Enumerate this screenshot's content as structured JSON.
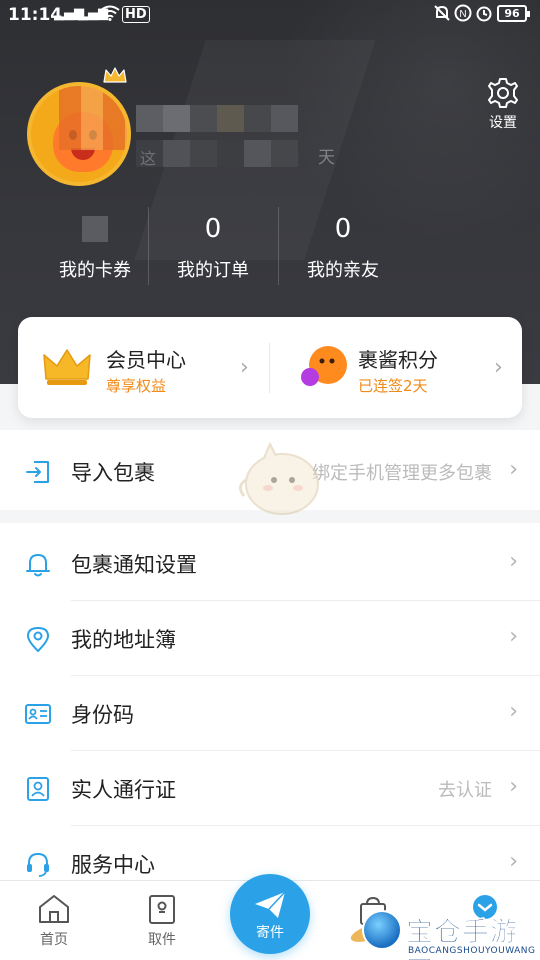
{
  "status_bar": {
    "time": "11:14",
    "signal_1": "▂▄▆ ",
    "signal_2": "▂▄▆",
    "hd": "HD",
    "battery": "96"
  },
  "header": {
    "settings_label": "设置",
    "name_prefix": "这",
    "name_suffix": "天",
    "stats": [
      {
        "label": "我的卡券"
      },
      {
        "value": "0",
        "label": "我的订单"
      },
      {
        "value": "0",
        "label": "我的亲友"
      }
    ]
  },
  "member_card": {
    "left": {
      "title": "会员中心",
      "subtitle": "尊享权益"
    },
    "right": {
      "title": "裹酱积分",
      "subtitle": "已连签2天"
    },
    "accent_color": "#f08a18"
  },
  "import_row": {
    "label": "导入包裹",
    "hint": "绑定手机管理更多包裹"
  },
  "menu": [
    {
      "label": "包裹通知设置",
      "icon": "bell-icon"
    },
    {
      "label": "我的地址簿",
      "icon": "location-pin-icon"
    },
    {
      "label": "身份码",
      "icon": "id-card-icon"
    },
    {
      "label": "实人通行证",
      "icon": "person-badge-icon",
      "right": "去认证"
    },
    {
      "label": "服务中心",
      "icon": "headset-icon"
    }
  ],
  "bottom_nav": {
    "tabs": [
      {
        "label": "首页",
        "icon": "home-icon"
      },
      {
        "label": "取件",
        "icon": "pickup-locker-icon"
      },
      {
        "label": "寄件",
        "icon": "paper-plane-icon"
      }
    ],
    "accent_color": "#2ba2e8"
  },
  "watermark": {
    "title": "宝仓手游网",
    "subtitle": "BAOCANGSHOUYOUWANG"
  }
}
